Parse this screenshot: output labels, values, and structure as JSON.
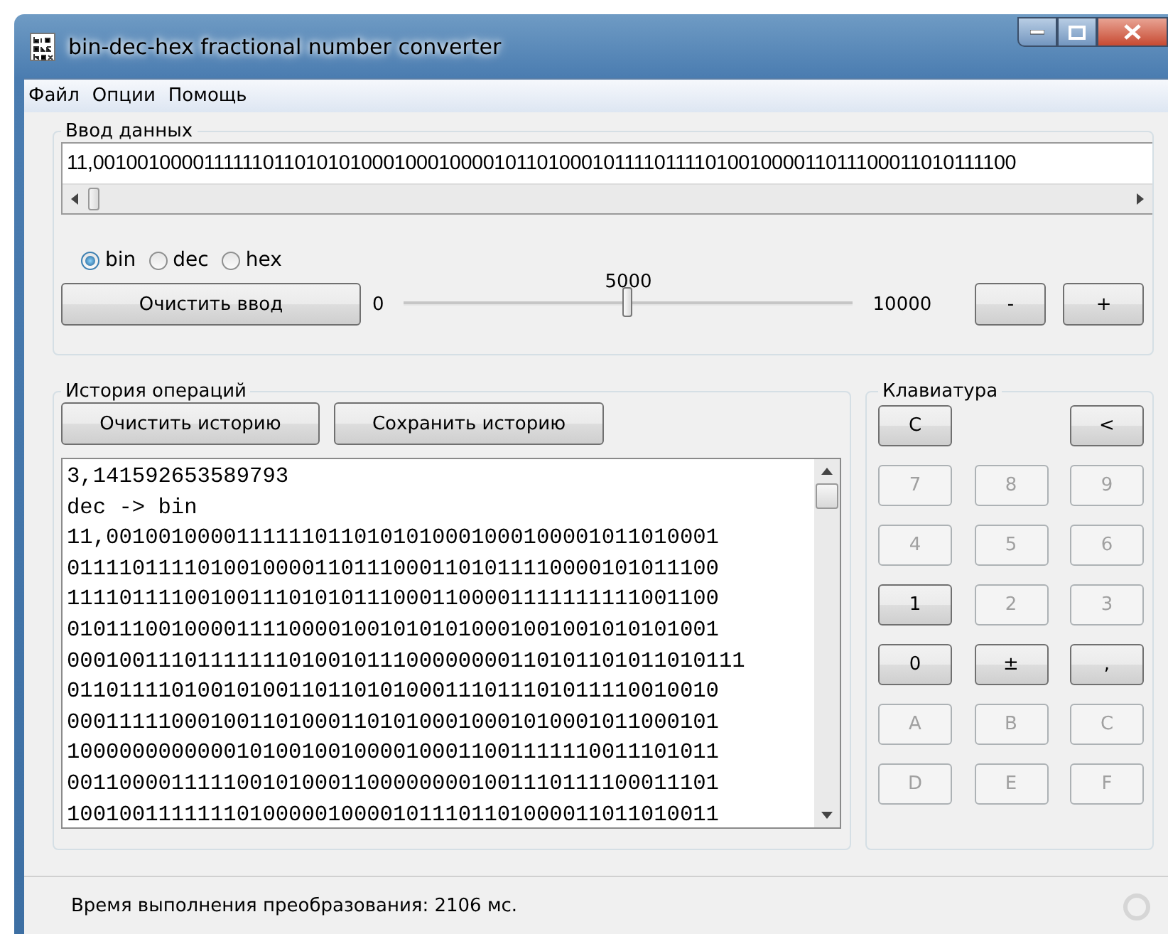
{
  "window": {
    "title": "bin-dec-hex fractional number converter"
  },
  "menu": [
    "Файл",
    "Опции",
    "Помощь"
  ],
  "input_group": {
    "title": "Ввод данных",
    "value": "11,00100100001111110110101010001000100001011010001011110111101001000011011100011010111100",
    "radios": [
      {
        "label": "bin",
        "selected": true
      },
      {
        "label": "dec",
        "selected": false
      },
      {
        "label": "hex",
        "selected": false
      }
    ],
    "clear_button": "Очистить ввод",
    "slider": {
      "min": "0",
      "max": "10000",
      "reading": "5000",
      "level": 0.5
    },
    "buttons": [
      "-",
      "+"
    ]
  },
  "history": {
    "title": "История операций",
    "buttons": [
      "Очистить историю",
      "Сохранить историю"
    ],
    "lines": [
      "3,141592653589793",
      "dec -> bin",
      "11,00100100001111110110101010001000100001011010001",
      "01111011110100100001101110001101011110000101011100",
      "11110111100100111010101110001100001111111111001100",
      "01011100100001111000010010101010001001001010101001",
      "0001001110111111101001011100000000110101101011010111",
      "01101111010010100110110101000111011101011110010010",
      "00011111000100110100011010100010001010001011000101",
      "10000000000001010010010000100011001111110011101011",
      "00110000111110010100011000000001001110111100011101",
      "10010011111110100000100001011101101000011011010011"
    ]
  },
  "keyboard": {
    "title": "Клавиатура",
    "rows": [
      [
        {
          "label": "C",
          "disabled": false
        },
        "",
        {
          "label": "<",
          "disabled": false
        }
      ],
      [
        {
          "label": "7",
          "disabled": true
        },
        {
          "label": "8",
          "disabled": true
        },
        {
          "label": "9",
          "disabled": true
        }
      ],
      [
        {
          "label": "4",
          "disabled": true
        },
        {
          "label": "5",
          "disabled": true
        },
        {
          "label": "6",
          "disabled": true
        }
      ],
      [
        {
          "label": "1",
          "disabled": false
        },
        {
          "label": "2",
          "disabled": true
        },
        {
          "label": "3",
          "disabled": true
        }
      ],
      [
        {
          "label": "0",
          "disabled": false
        },
        {
          "label": "±",
          "disabled": false
        },
        {
          "label": ",",
          "disabled": false
        }
      ],
      [
        {
          "label": "A",
          "disabled": true
        },
        {
          "label": "B",
          "disabled": true
        },
        {
          "label": "C",
          "disabled": true
        }
      ],
      [
        {
          "label": "D",
          "disabled": true
        },
        {
          "label": "E",
          "disabled": true
        },
        {
          "label": "F",
          "disabled": true
        }
      ]
    ]
  },
  "status_bar": "Время выполнения преобразования: 2106 мс."
}
